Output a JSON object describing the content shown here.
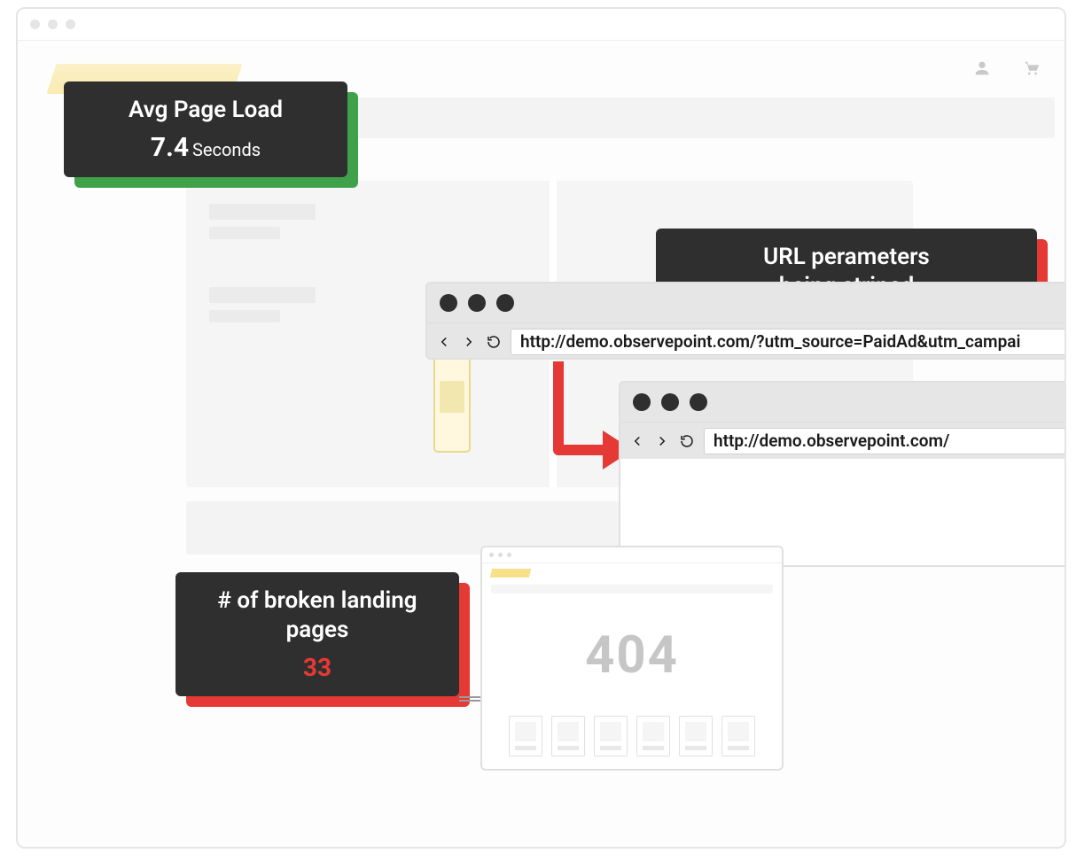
{
  "callouts": {
    "load": {
      "title": "Avg Page Load",
      "value": "7.4",
      "unit": "Seconds"
    },
    "url_stripped": {
      "title_line1": "URL perameters",
      "title_line2": "being striped"
    },
    "broken": {
      "title_line1": "# of broken landing",
      "title_line2": "pages",
      "value": "33"
    }
  },
  "browsers": {
    "before_url": "http://demo.observepoint.com/?utm_source=PaidAd&utm_campai",
    "after_url": "http://demo.observepoint.com/"
  },
  "tiny_page": {
    "status_code": "404"
  },
  "colors": {
    "callout_bg": "#2F2F2F",
    "accent_green": "#3FA14A",
    "accent_red": "#E53935",
    "brand_yellow": "#F7E08A"
  }
}
